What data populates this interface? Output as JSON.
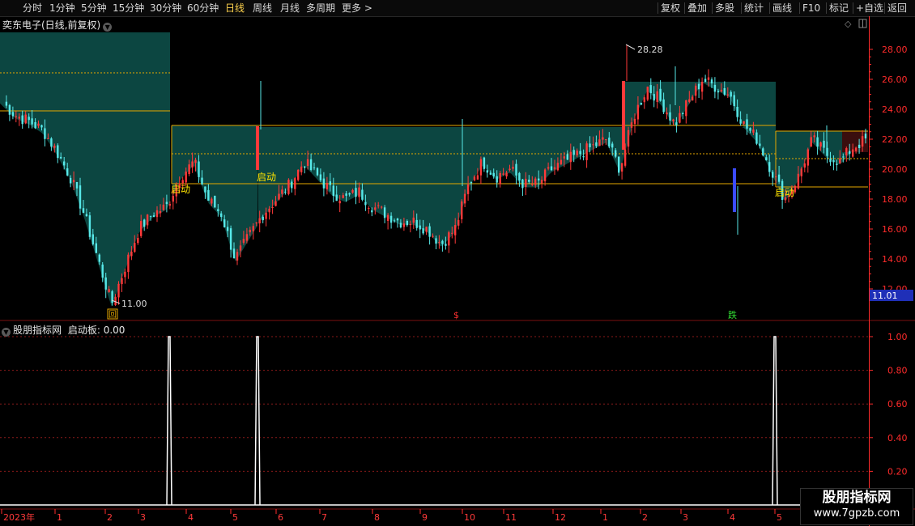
{
  "toolbar": {
    "left_items": [
      "分时",
      "1分钟",
      "5分钟",
      "15分钟",
      "30分钟",
      "60分钟",
      "日线",
      "周线",
      "月线",
      "多周期",
      "更多 >"
    ],
    "active_item": "日线",
    "right_items": [
      "复权",
      "叠加",
      "多股",
      "统计",
      "画线",
      "F10",
      "标记",
      "+自选",
      "返回"
    ]
  },
  "main_pane": {
    "title": "奕东电子(日线,前复权)",
    "price_ticks": [
      "28.00",
      "26.00",
      "24.00",
      "22.00",
      "20.00",
      "18.00",
      "16.00",
      "14.00",
      "12.00"
    ],
    "current_price": "11.01",
    "high_label": "28.28",
    "low_label": "11.00",
    "signal_label": "启动",
    "markers": [
      "回",
      "$",
      "跌"
    ],
    "colors": {
      "up": "#ff3a3a",
      "up_stick": "#ff5a5a",
      "down": "#57e8e8",
      "fill": "#0d4a45",
      "line": "#e6a800",
      "axis": "#ff2b2b"
    }
  },
  "sub_pane": {
    "title": "股朋指标网",
    "indicator": "启动板: 0.00",
    "ticks": [
      "1.00",
      "0.80",
      "0.60",
      "0.40",
      "0.20"
    ]
  },
  "time_axis": {
    "labels": [
      "2023年",
      "1",
      "2",
      "3",
      "4",
      "5",
      "6",
      "7",
      "8",
      "9",
      "10",
      "11",
      "12",
      "1",
      "2",
      "3",
      "4",
      "5"
    ]
  },
  "watermark": {
    "line1": "股朋指标网",
    "line2": "www.7gpzb.com"
  },
  "chart_data": {
    "type": "candlestick",
    "title": "奕东电子(日线,前复权)",
    "ylim": [
      11.0,
      29.0
    ],
    "x": [
      "2023-01",
      "2023-02",
      "2023-03",
      "2023-04",
      "2023-05",
      "2023-06",
      "2023-07",
      "2023-08",
      "2023-09",
      "2023-10",
      "2023-11",
      "2023-12",
      "2024-01",
      "2024-02",
      "2024-03",
      "2024-04",
      "2024-05"
    ],
    "close_path": [
      24.5,
      23.6,
      23.2,
      22.6,
      21.2,
      19.5,
      17.0,
      14.0,
      11.0,
      13.5,
      16.0,
      17.0,
      17.5,
      19.5,
      20.5,
      18.0,
      17.0,
      14.0,
      15.5,
      17.0,
      18.0,
      19.0,
      20.5,
      19.5,
      18.5,
      18.0,
      18.5,
      17.5,
      17.0,
      16.5,
      16.5,
      16.0,
      15.0,
      16.0,
      19.0,
      20.5,
      19.5,
      20.0,
      19.0,
      19.0,
      20.0,
      20.5,
      21.0,
      21.5,
      22.0,
      20.0,
      23.5,
      25.5,
      24.5,
      23.0,
      24.5,
      26.0,
      25.5,
      25.0,
      23.0,
      22.0,
      20.0,
      18.0,
      19.5,
      22.0,
      21.0,
      20.5,
      21.5,
      22.0
    ],
    "signal_days": [
      209,
      318,
      957
    ],
    "high": 28.28,
    "low": 11.0,
    "last": 11.01
  }
}
